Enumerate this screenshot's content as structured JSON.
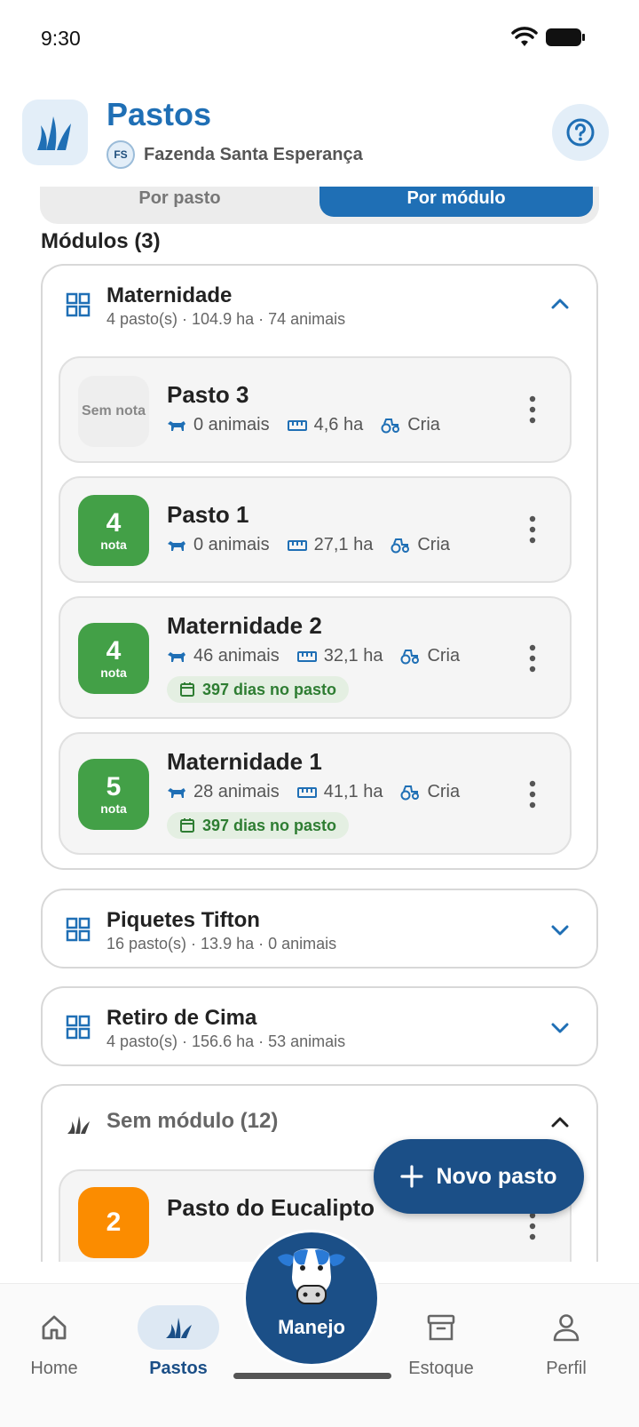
{
  "status_bar": {
    "time": "9:30"
  },
  "header": {
    "title": "Pastos",
    "farm_initials": "FS",
    "farm_name": "Fazenda Santa Esperança"
  },
  "view_toggle": {
    "option_pasture": "Por pasto",
    "option_module": "Por módulo",
    "selected": "Por módulo"
  },
  "modules_heading": "Módulos (3)",
  "modules": [
    {
      "name": "Maternidade",
      "summary": "4 pasto(s) · 104.9 ha · 74 animais",
      "expanded": true,
      "pastures": [
        {
          "name": "Pasto 3",
          "score": "",
          "score_label": "Sem nota",
          "animals": "0 animais",
          "area": "4,6 ha",
          "category": "Cria",
          "days": ""
        },
        {
          "name": "Pasto 1",
          "score": "4",
          "score_label": "nota",
          "animals": "0 animais",
          "area": "27,1 ha",
          "category": "Cria",
          "days": ""
        },
        {
          "name": "Maternidade 2",
          "score": "4",
          "score_label": "nota",
          "animals": "46 animais",
          "area": "32,1 ha",
          "category": "Cria",
          "days": "397 dias no pasto"
        },
        {
          "name": "Maternidade 1",
          "score": "5",
          "score_label": "nota",
          "animals": "28 animais",
          "area": "41,1 ha",
          "category": "Cria",
          "days": "397 dias no pasto"
        }
      ]
    },
    {
      "name": "Piquetes Tifton",
      "summary": "16 pasto(s) · 13.9 ha · 0 animais",
      "expanded": false
    },
    {
      "name": "Retiro de Cima",
      "summary": "4 pasto(s) · 156.6 ha · 53 animais",
      "expanded": false
    }
  ],
  "no_module": {
    "title": "Sem módulo (12)",
    "expanded": true,
    "first_pasture": {
      "name": "Pasto do Eucalipto",
      "score": "2"
    }
  },
  "fab_label": "Novo pasto",
  "bottom_nav": {
    "home": "Home",
    "pastos": "Pastos",
    "manejo": "Manejo",
    "estoque": "Estoque",
    "perfil": "Perfil",
    "active": "Pastos"
  },
  "colors": {
    "primary": "#1f6fb5",
    "dark_primary": "#1b4f87",
    "score_green": "#43a047",
    "score_orange": "#fb8c00"
  }
}
